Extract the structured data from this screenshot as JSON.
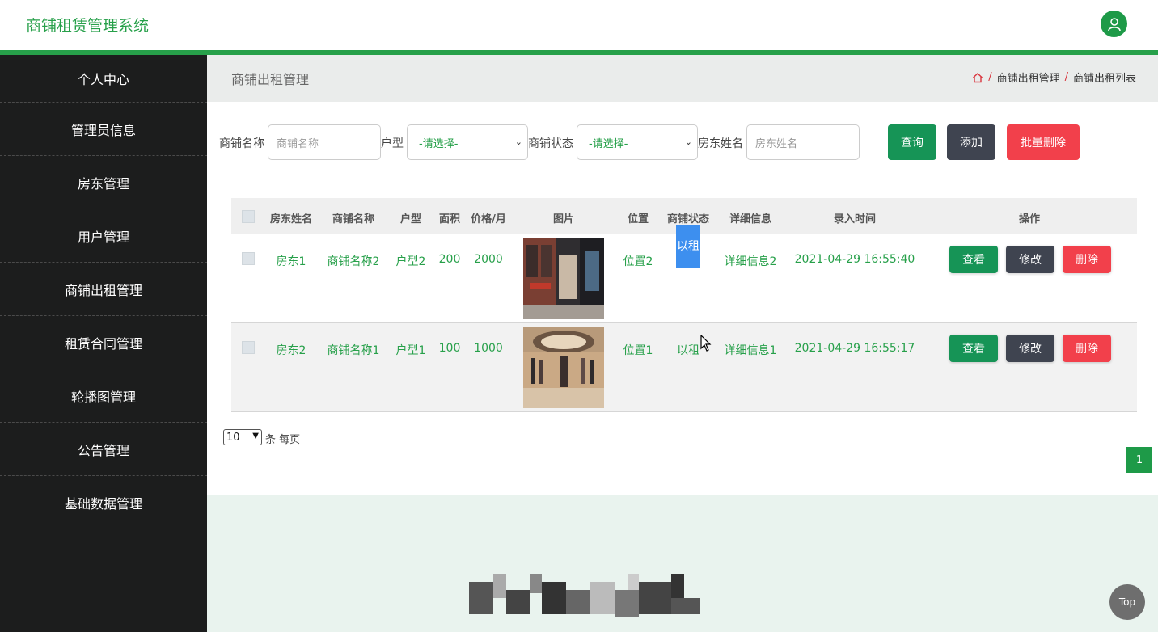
{
  "app": {
    "title": "商铺租赁管理系统"
  },
  "sidebar": {
    "items": [
      {
        "label": "个人中心"
      },
      {
        "label": "管理员信息"
      },
      {
        "label": "房东管理"
      },
      {
        "label": "用户管理"
      },
      {
        "label": "商铺出租管理"
      },
      {
        "label": "租赁合同管理"
      },
      {
        "label": "轮播图管理"
      },
      {
        "label": "公告管理"
      },
      {
        "label": "基础数据管理"
      }
    ]
  },
  "page": {
    "title": "商铺出租管理",
    "breadcrumb": [
      "商铺出租管理",
      "商铺出租列表"
    ]
  },
  "filters": {
    "shop_name_label": "商铺名称",
    "shop_name_placeholder": "商铺名称",
    "unit_type_label": "户型",
    "unit_type_value": "-请选择-",
    "status_label": "商铺状态",
    "status_value": "-请选择-",
    "landlord_label": "房东姓名",
    "landlord_placeholder": "房东姓名",
    "query_label": "查询",
    "add_label": "添加",
    "batch_delete_label": "批量删除"
  },
  "table": {
    "headers": [
      "房东姓名",
      "商铺名称",
      "户型",
      "面积",
      "价格/月",
      "图片",
      "位置",
      "商铺状态",
      "详细信息",
      "录入时间",
      "操作"
    ],
    "rows": [
      {
        "landlord": "房东1",
        "shop": "商铺名称2",
        "type": "户型2",
        "area": "200",
        "price": "2000",
        "location": "位置2",
        "status": "以租",
        "detail": "详细信息2",
        "time": "2021-04-29 16:55:40"
      },
      {
        "landlord": "房东2",
        "shop": "商铺名称1",
        "type": "户型1",
        "area": "100",
        "price": "1000",
        "location": "位置1",
        "status": "以租",
        "detail": "详细信息1",
        "time": "2021-04-29 16:55:17"
      }
    ],
    "actions": {
      "view": "查看",
      "edit": "修改",
      "delete": "删除"
    }
  },
  "pagination": {
    "page_size": "10",
    "page_size_suffix": "条 每页",
    "current_page": "1"
  },
  "top_button": "Top",
  "colors": {
    "brand_green": "#27a04a",
    "sidebar_bg": "#1c1d1d",
    "query_button": "#169456",
    "add_button": "#3f4450",
    "delete_button": "#f2404b",
    "status_highlight": "#3d8fef"
  }
}
